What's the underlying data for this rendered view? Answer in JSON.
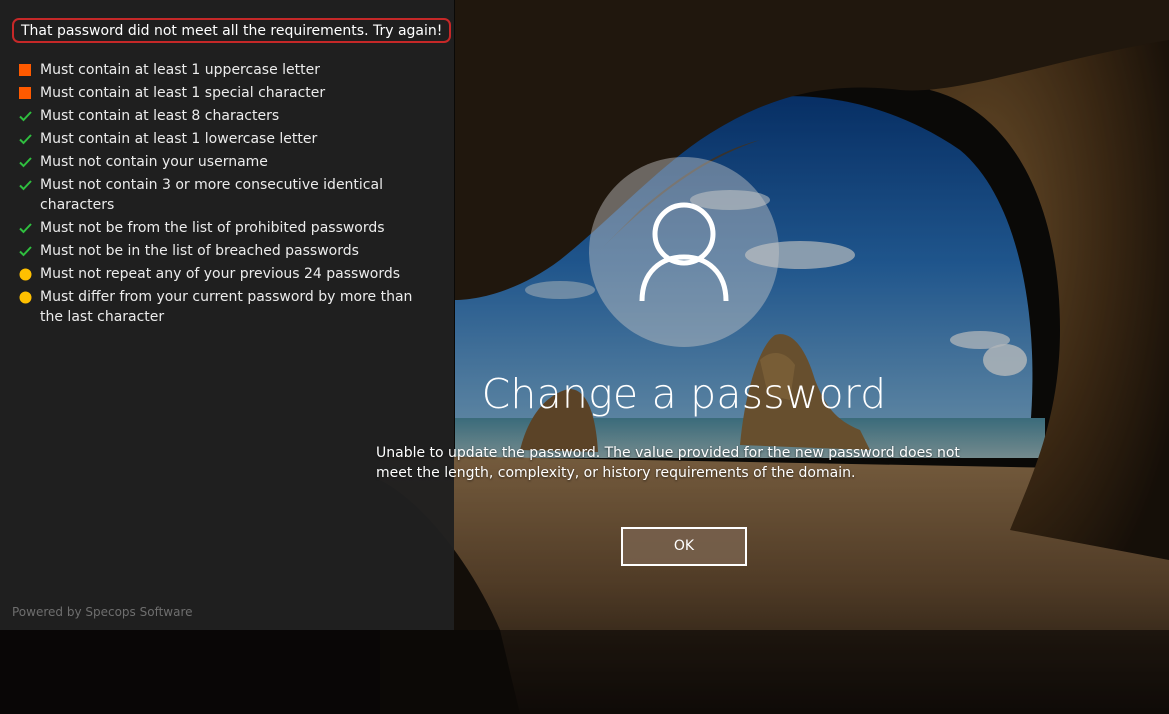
{
  "requirements_panel": {
    "error_message": "That password did not meet all the requirements. Try again!",
    "items": [
      {
        "label": "Must contain at least 1 uppercase letter",
        "status": "failed",
        "icon": "orange-square-icon"
      },
      {
        "label": "Must contain at least 1 special character",
        "status": "failed",
        "icon": "orange-square-icon"
      },
      {
        "label": "Must contain at least 8 characters",
        "status": "passed",
        "icon": "green-check-icon"
      },
      {
        "label": "Must contain at least 1 lowercase letter",
        "status": "passed",
        "icon": "green-check-icon"
      },
      {
        "label": "Must not contain your username",
        "status": "passed",
        "icon": "green-check-icon"
      },
      {
        "label": "Must not contain 3 or more consecutive identical characters",
        "status": "passed",
        "icon": "green-check-icon"
      },
      {
        "label": "Must not be from the list of prohibited passwords",
        "status": "passed",
        "icon": "green-check-icon"
      },
      {
        "label": "Must not be in the list of breached passwords",
        "status": "passed",
        "icon": "green-check-icon"
      },
      {
        "label": "Must not repeat any of your previous 24 passwords",
        "status": "pending",
        "icon": "yellow-dot-icon"
      },
      {
        "label": "Must differ from your current password by more than the last character",
        "status": "pending",
        "icon": "yellow-dot-icon"
      }
    ],
    "footer": "Powered by Specops Software"
  },
  "dialog": {
    "avatar_icon": "user-icon",
    "title": "Change a password",
    "message": "Unable to update the password. The value provided for the new password does not meet the length, complexity, or history requirements of the domain.",
    "ok_label": "OK"
  },
  "colors": {
    "failed": "#ff5a00",
    "passed": "#2fbf3f",
    "pending": "#ffc000",
    "error_border": "#c62828"
  }
}
